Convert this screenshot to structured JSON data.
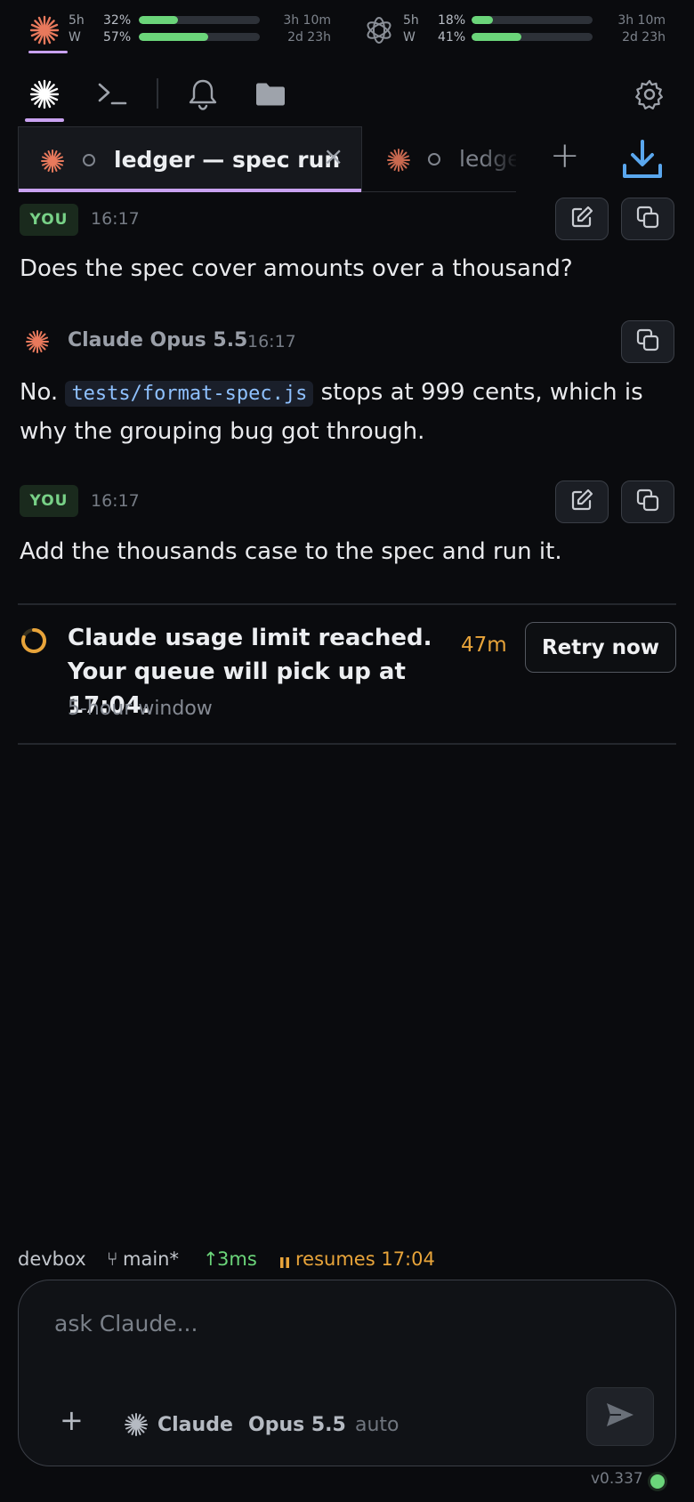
{
  "usage": {
    "claude": {
      "icon": "claude-logo-icon",
      "rows": [
        {
          "label": "5h",
          "pct": "32%",
          "fill": 0.32,
          "time": "3h 10m"
        },
        {
          "label": "W",
          "pct": "57%",
          "fill": 0.57,
          "time": "2d 23h"
        }
      ]
    },
    "openai": {
      "icon": "openai-logo-icon",
      "rows": [
        {
          "label": "5h",
          "pct": "18%",
          "fill": 0.18,
          "time": "3h 10m"
        },
        {
          "label": "W",
          "pct": "41%",
          "fill": 0.41,
          "time": "2d 23h"
        }
      ]
    }
  },
  "toolbar": {
    "icons": [
      "claude-sparkle-icon",
      "terminal-icon",
      "bell-icon",
      "folder-icon",
      "gear-icon"
    ]
  },
  "tabs": [
    {
      "title": "ledger — spec run",
      "active": true,
      "close": "×"
    },
    {
      "title": "ledger — spec run",
      "active": false
    }
  ],
  "tabbar": {
    "add_label": "+",
    "download_icon": "download-icon"
  },
  "messages": [
    {
      "role": "YOU",
      "time": "16:17",
      "text": "Does the spec cover amounts over a thousand?"
    },
    {
      "role": "assistant",
      "model": "Claude Opus 5.5",
      "time": "16:17",
      "text_pre": "No.",
      "code": "tests/format-spec.js",
      "text_post": "stops at 999 cents, which is why the grouping bug got through."
    },
    {
      "role": "YOU",
      "time": "16:17",
      "text": "Add the thousands case to the spec and run it."
    }
  ],
  "notice": {
    "title_line1": "Claude usage limit reached.",
    "title_line2": "Your queue will pick up at 17:04.",
    "subtitle": "5-hour window",
    "countdown": "47m",
    "retry_label": "Retry now",
    "accent": "#e8a43a"
  },
  "status": {
    "host": "devbox",
    "branch_icon": "⑂",
    "branch": "main*",
    "latency_icon": "↑",
    "latency": "3ms",
    "paused_icon": "pause-icon",
    "paused_text": "resumes 17:04"
  },
  "composer": {
    "placeholder": "ask Claude...",
    "add_label": "+",
    "provider": "Claude",
    "model": "Opus 5.5",
    "mode": "auto"
  },
  "footer": {
    "version": "v0.337",
    "status_color": "#6bd57a"
  }
}
